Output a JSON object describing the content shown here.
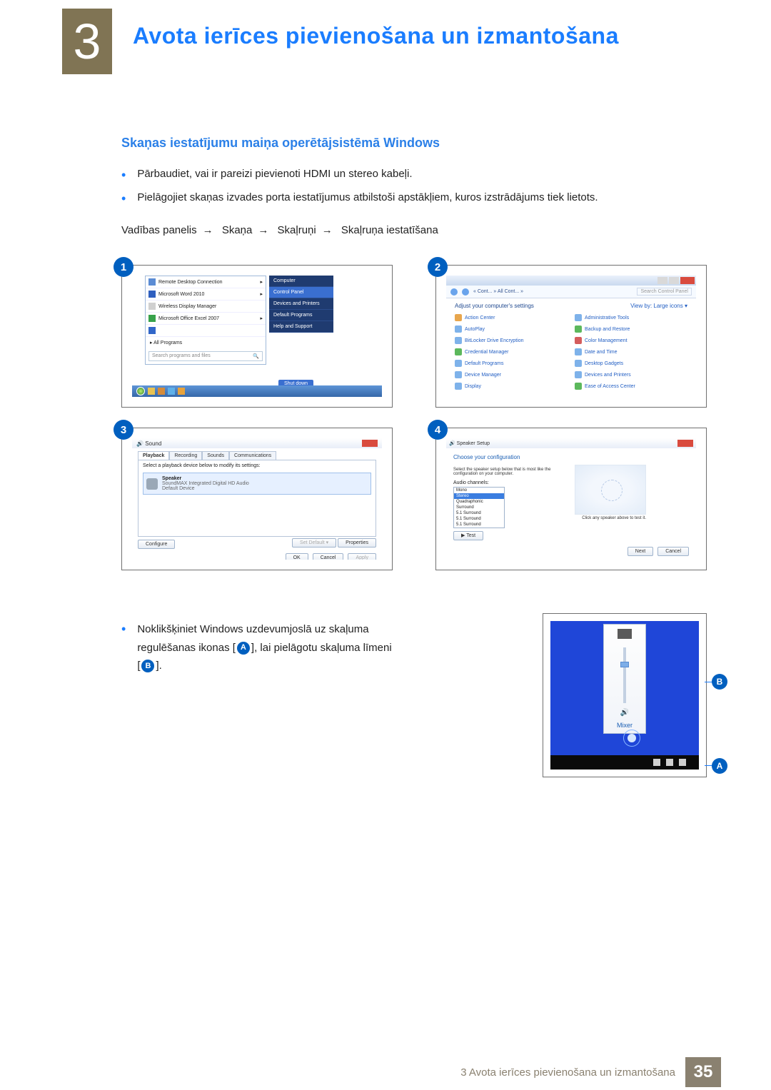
{
  "chapter": {
    "number": "3",
    "title": "Avota ierīces pievienošana un izmantošana"
  },
  "section": {
    "subhead": "Skaņas iestatījumu maiņa operētājsistēmā Windows"
  },
  "bullets": [
    "Pārbaudiet, vai ir pareizi pievienoti HDMI un stereo kabeļi.",
    "Pielāgojiet skaņas izvades porta iestatījumus atbilstoši apstākļiem, kuros izstrādājums tiek lietots."
  ],
  "path": {
    "p0": "Vadības panelis",
    "p1": "Skaņa",
    "p2": "Skaļruņi",
    "p3": "Skaļruņa iestatīšana"
  },
  "panel1": {
    "items": [
      "Remote Desktop Connection",
      "Microsoft Word 2010",
      "Wireless Display Manager",
      "Microsoft Office Excel 2007"
    ],
    "allprograms": "All Programs",
    "search": "Search programs and files",
    "right": [
      "Computer",
      "Control Panel",
      "Devices and Printers",
      "Default Programs",
      "Help and Support"
    ],
    "shutdown": "Shut down"
  },
  "panel2": {
    "addrbar": "« Cont... » All Cont... »",
    "searchph": "Search Control Panel",
    "adjust": "Adjust your computer's settings",
    "view": "View by:  Large icons ▾",
    "left": [
      "Action Center",
      "AutoPlay",
      "BitLocker Drive Encryption",
      "Credential Manager",
      "Default Programs",
      "Device Manager",
      "Display"
    ],
    "right": [
      "Administrative Tools",
      "Backup and Restore",
      "Color Management",
      "Date and Time",
      "Desktop Gadgets",
      "Devices and Printers",
      "Ease of Access Center"
    ]
  },
  "panel3": {
    "title": "Sound",
    "tabs": [
      "Playback",
      "Recording",
      "Sounds",
      "Communications"
    ],
    "hint": "Select a playback device below to modify its settings:",
    "dev_name": "Speaker",
    "dev_sub": "SoundMAX Integrated Digital HD Audio",
    "dev_def": "Default Device",
    "configure": "Configure",
    "setdefault": "Set Default ▾",
    "properties": "Properties",
    "ok": "OK",
    "cancel": "Cancel",
    "apply": "Apply"
  },
  "panel4": {
    "title": "Speaker Setup",
    "choose": "Choose your configuration",
    "sub": "Select the speaker setup below that is most like the configuration on your computer.",
    "label": "Audio channels:",
    "list": [
      "Mono",
      "Stereo",
      "Quadraphonic",
      "Surround",
      "5.1 Surround",
      "5.1 Surround",
      "5.1 Surround"
    ],
    "test": "▶ Test",
    "click": "Click any speaker above to test it.",
    "next": "Next",
    "cancel": "Cancel"
  },
  "lower": {
    "line1": "Noklikšķiniet Windows uzdevumjoslā uz skaļuma",
    "line2a": "regulēšanas ikonas [",
    "line2b": "], lai pielāgotu skaļuma līmeni",
    "line3a": "[",
    "line3b": "].",
    "mixer": "Mixer",
    "labelA": "A",
    "labelB": "B"
  },
  "footer": {
    "text": "3 Avota ierīces pievienošana un izmantošana",
    "page": "35"
  }
}
